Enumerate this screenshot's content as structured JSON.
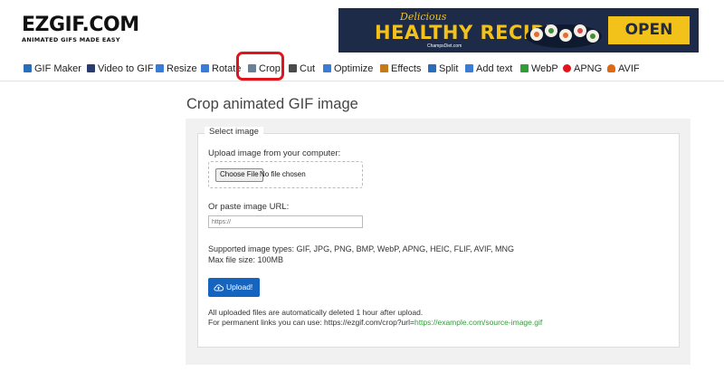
{
  "logo": {
    "main": "EZGIF.COM",
    "tagline": "ANIMATED GIFS MADE EASY"
  },
  "ad": {
    "top": "Delicious",
    "title": "HEALTHY RECIPES",
    "site": "ChampsDiet.com",
    "cta": "OPEN"
  },
  "nav": [
    {
      "label": "GIF Maker",
      "icon": "gif-maker-icon",
      "color": "#2a6ebb"
    },
    {
      "label": "Video to GIF",
      "icon": "video-icon",
      "color": "#2b3b6e"
    },
    {
      "label": "Resize",
      "icon": "resize-icon",
      "color": "#3a7bd5"
    },
    {
      "label": "Rotate",
      "icon": "rotate-icon",
      "color": "#3a7bd5"
    },
    {
      "label": "Crop",
      "icon": "crop-icon",
      "color": "#6b7f95"
    },
    {
      "label": "Cut",
      "icon": "cut-icon",
      "color": "#4a4a4a"
    },
    {
      "label": "Optimize",
      "icon": "optimize-icon",
      "color": "#3a7bd5"
    },
    {
      "label": "Effects",
      "icon": "effects-icon",
      "color": "#c47a1a"
    },
    {
      "label": "Split",
      "icon": "split-icon",
      "color": "#2a6ebb"
    },
    {
      "label": "Add text",
      "icon": "add-text-icon",
      "color": "#3a7bd5"
    },
    {
      "label": "WebP",
      "icon": "webp-icon",
      "color": "#2f9d38"
    },
    {
      "label": "APNG",
      "icon": "apng-icon",
      "color": "#e0141c"
    },
    {
      "label": "AVIF",
      "icon": "avif-icon",
      "color": "#e06a14"
    }
  ],
  "page": {
    "title": "Crop animated GIF image"
  },
  "form": {
    "legend": "Select image",
    "upload_label": "Upload image from your computer:",
    "file_button": "Choose File",
    "file_status": "No file chosen",
    "url_label": "Or paste image URL:",
    "url_placeholder": "https://",
    "types_line": "Supported image types: GIF, JPG, PNG, BMP, WebP, APNG, HEIC, FLIF, AVIF, MNG",
    "max_size": "Max file size: 100MB",
    "upload_button": "Upload!",
    "note1": "All uploaded files are automatically deleted 1 hour after upload.",
    "note2_prefix": "For permanent links you can use: https://ezgif.com/crop?url=",
    "note2_link": "https://example.com/source-image.gif"
  },
  "colors": {
    "highlight": "#e0141c",
    "button": "#1565c0",
    "link": "#2f9d38"
  }
}
